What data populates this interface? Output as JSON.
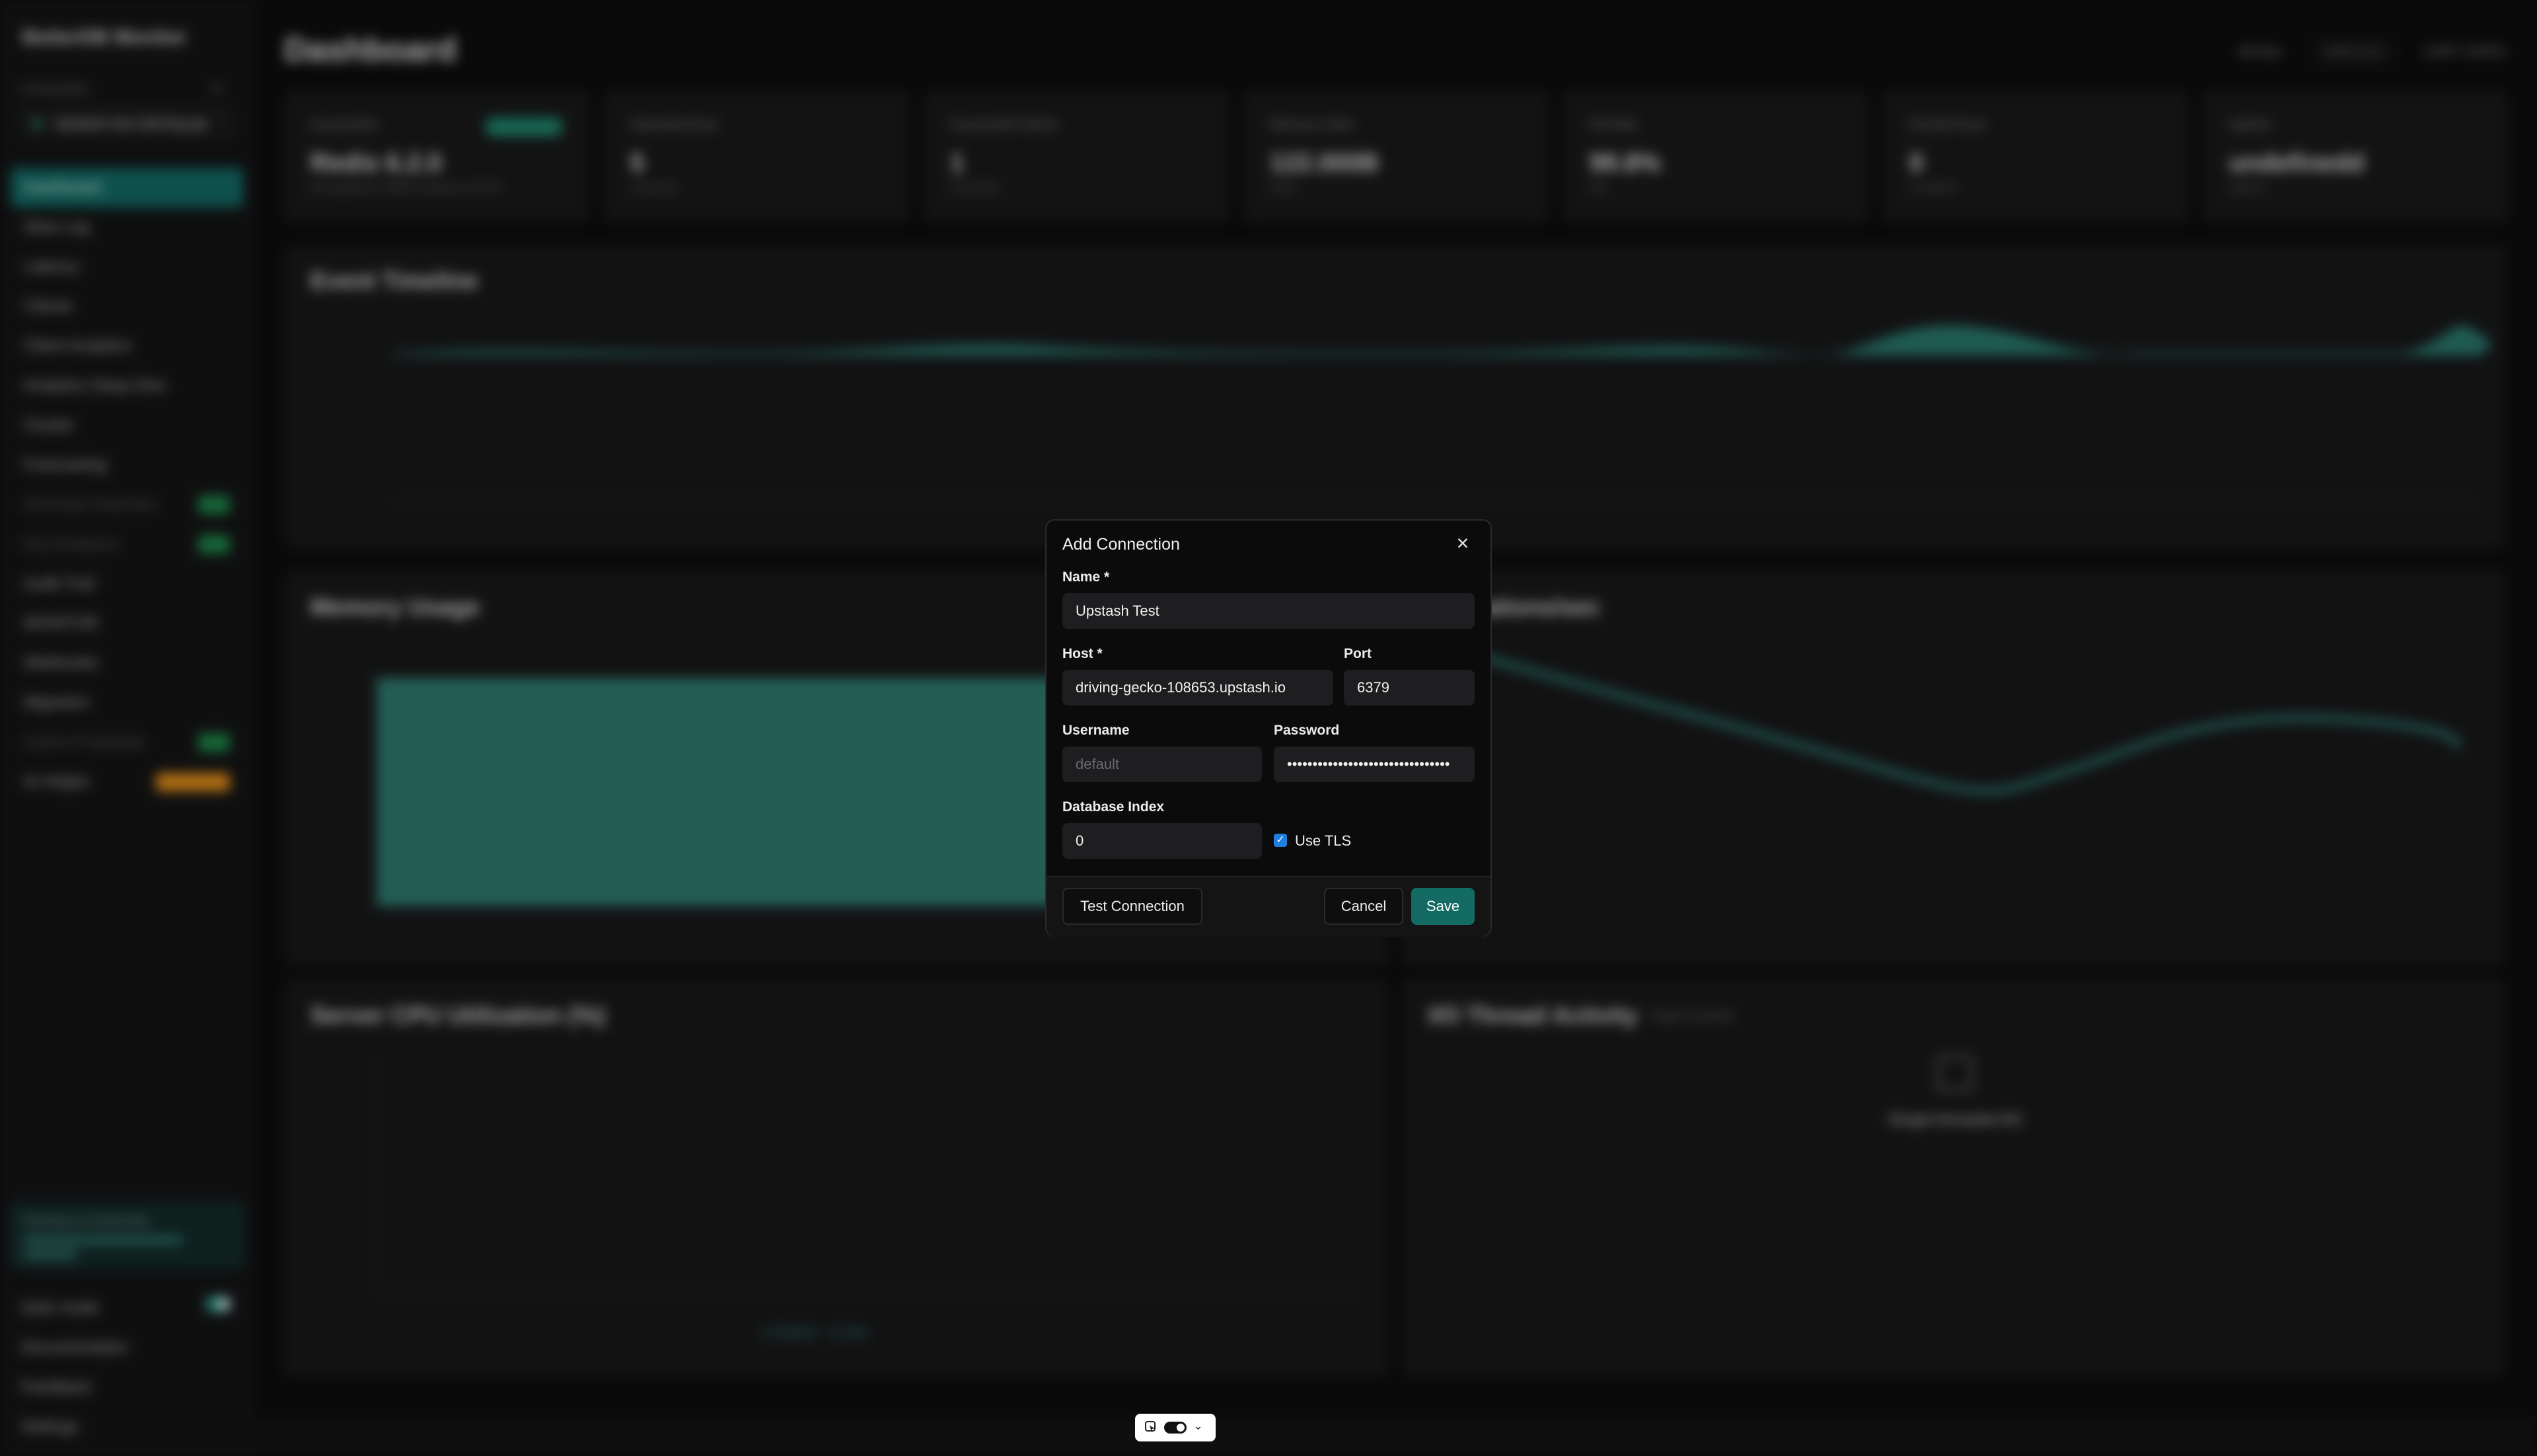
{
  "sidebar": {
    "app_title": "BetterDB Monitor",
    "connection_label": "Connection",
    "connection_value": "Upstash test (driving-ge",
    "nav_items": [
      {
        "label": "Dashboard"
      },
      {
        "label": "Slow Log"
      },
      {
        "label": "Latency"
      },
      {
        "label": "Clients"
      },
      {
        "label": "Client Analytics"
      },
      {
        "label": "Analytics Deep Dive"
      },
      {
        "label": "Cluster"
      },
      {
        "label": "Forecasting"
      },
      {
        "label": "Anomaly Detection"
      },
      {
        "label": "Key Analytics"
      },
      {
        "label": "Audit Trail"
      },
      {
        "label": "MONITOR"
      },
      {
        "label": "Webhooks"
      },
      {
        "label": "Migration"
      },
      {
        "label": "Cache Proposals"
      },
      {
        "label": "AI Helper"
      }
    ],
    "community_text": "Running on Community",
    "bottom_items": [
      {
        "label": "Dark mode"
      },
      {
        "label": "Documentation"
      },
      {
        "label": "Feedback"
      },
      {
        "label": "Settings"
      }
    ]
  },
  "header": {
    "title": "Dashboard",
    "actions": [
      "All time",
      "CAN 8.2.0",
      "COPY STATS"
    ]
  },
  "stats": [
    {
      "label": "Connection",
      "value": "Redis 6.2.0",
      "sub": "driving-gecko-108653.upstash.io:6379"
    },
    {
      "label": "Operations/sec",
      "value": "5",
      "sub": "5 ops/sec"
    },
    {
      "label": "Connected Clients",
      "value": "1",
      "sub": "0 blocked"
    },
    {
      "label": "Memory Used",
      "value": "122.000B",
      "sub": "Peak"
    },
    {
      "label": "Hit Rate",
      "value": "99.8%",
      "sub": "hits"
    },
    {
      "label": "Evicted Keys",
      "value": "0",
      "sub": "0 expired"
    },
    {
      "label": "Uptime",
      "value": "undefinedd",
      "sub": "Uptime"
    }
  ],
  "panels": {
    "event_timeline": "Event Timeline",
    "memory_usage": "Memory Usage",
    "ops_per_sec": "Operations/sec",
    "cpu": "Server CPU Utilization (%)",
    "io_threads": "I/O Thread Activity",
    "io_threads_tag": "Single-threaded",
    "io_heading": "Single-threaded I/O",
    "cpu_legend": [
      "System",
      "User"
    ]
  },
  "modal": {
    "title": "Add Connection",
    "name_label": "Name *",
    "name_value": "Upstash Test",
    "host_label": "Host *",
    "host_value": "driving-gecko-108653.upstash.io",
    "port_label": "Port",
    "port_value": "6379",
    "username_label": "Username",
    "username_placeholder": "default",
    "password_label": "Password",
    "password_value": "••••••••••••••••••••••••••••••••",
    "db_index_label": "Database Index",
    "db_index_value": "0",
    "tls_label": "Use TLS",
    "tls_checked": true,
    "test_button": "Test Connection",
    "cancel_button": "Cancel",
    "save_button": "Save"
  },
  "colors": {
    "accent": "#146b63",
    "background": "#0e0e0f",
    "checkbox": "#1e7fe0"
  }
}
